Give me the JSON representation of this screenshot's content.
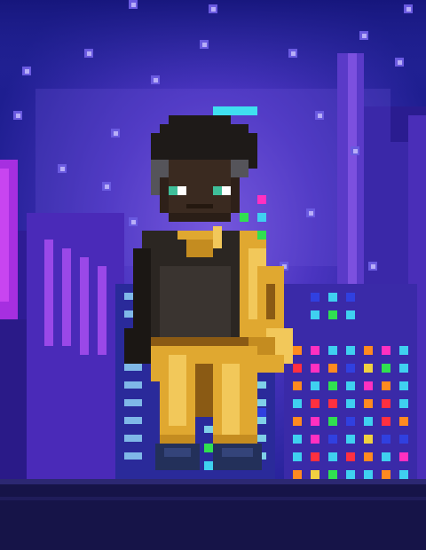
{
  "scene": {
    "subject": "pixel-art-character",
    "setting": "neon-city-night"
  },
  "colors": {
    "sky_top": "#1b1f8f",
    "sky_mid": "#3a2fb8",
    "sky_glow": "#6b4fd8",
    "building_dark": "#2a1a80",
    "building_mid": "#3b20a0",
    "neon_purple": "#8a2be2",
    "neon_magenta": "#c02bd8",
    "ground": "#1a1650",
    "ground_edge": "#2b2470",
    "outfit_black": "#2b2622",
    "outfit_dark": "#1b1714",
    "gold": "#e0a830",
    "gold_light": "#f2c85a",
    "gold_shadow": "#8a5a14",
    "skin": "#3a2a20",
    "hair": "#1e1a18",
    "eye": "#3fbf9a",
    "halo": "#3fe0f0",
    "boots": "#23305a"
  },
  "icons": {
    "character": "character-sprite-icon",
    "halo": "halo-icon"
  }
}
